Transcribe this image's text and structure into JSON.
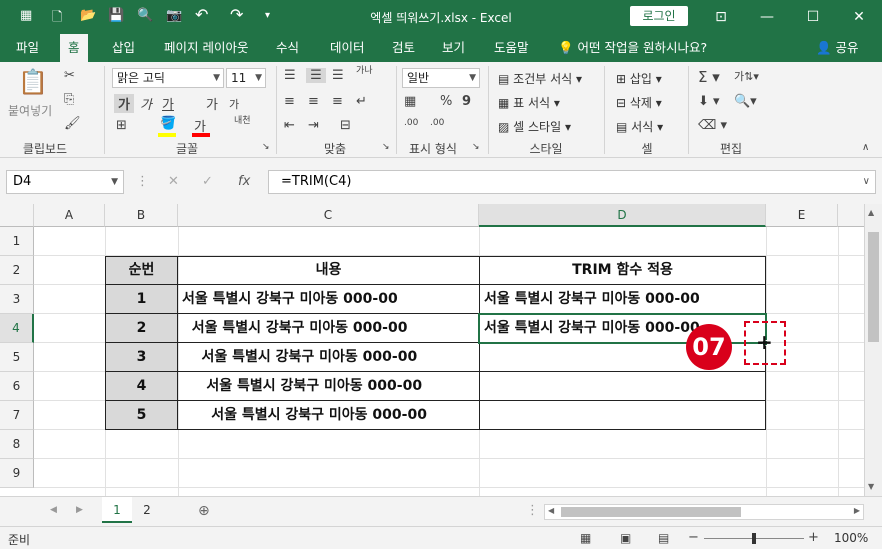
{
  "window": {
    "title": "엑셀 띄워쓰기.xlsx  -  Excel",
    "login_label": "로그인",
    "quick_access": {
      "save": "💾",
      "undo": "↶",
      "redo": "↷"
    }
  },
  "menu": {
    "tabs": [
      "파일",
      "홈",
      "삽입",
      "페이지 레이아웃",
      "수식",
      "데이터",
      "검토",
      "보기",
      "도움말"
    ],
    "active_tab": "홈",
    "tell_me": "어떤 작업을 원하시나요?",
    "share": "공유"
  },
  "ribbon": {
    "clipboard": {
      "paste": "붙여넣기",
      "label": "클립보드"
    },
    "font": {
      "name": "맑은 고딕",
      "size": "11",
      "bold": "가",
      "italic": "가",
      "underline": "가",
      "grow": "가",
      "shrink": "가",
      "phonetic": "내천",
      "color_glyph": "가",
      "label": "글꼴"
    },
    "alignment": {
      "wrap": "가나",
      "label": "맞춤"
    },
    "number": {
      "format": "일반",
      "percent": "%",
      "comma": "9",
      "inc": ".00",
      "dec": ".00",
      "label": "표시 형식"
    },
    "styles": {
      "conditional": "조건부 서식",
      "table": "표 서식",
      "cell": "셀 스타일",
      "label": "스타일"
    },
    "cells": {
      "insert": "삽입",
      "delete": "삭제",
      "format": "서식",
      "label": "셀"
    },
    "editing": {
      "sort": "가",
      "label": "편집"
    }
  },
  "formula_bar": {
    "name_box": "D4",
    "formula": "=TRIM(C4)",
    "fx": "fx"
  },
  "columns": [
    "A",
    "B",
    "C",
    "D",
    "E"
  ],
  "rows": [
    "1",
    "2",
    "3",
    "4",
    "5",
    "6",
    "7",
    "8",
    "9"
  ],
  "table": {
    "header": {
      "b": "순번",
      "c": "내용",
      "d": "TRIM 함수 적용"
    },
    "rows": [
      {
        "b": "1",
        "c": "서울 특별시 강북구 미아동 000-00",
        "d": "서울 특별시 강북구 미아동 000-00"
      },
      {
        "b": "2",
        "c": "  서울 특별시 강북구 미아동 000-00",
        "d": "서울 특별시 강북구 미아동 000-00"
      },
      {
        "b": "3",
        "c": "    서울 특별시 강북구 미아동 000-00",
        "d": ""
      },
      {
        "b": "4",
        "c": "     서울 특별시 강북구 미아동 000-00",
        "d": ""
      },
      {
        "b": "5",
        "c": "      서울 특별시 강북구 미아동 000-00",
        "d": ""
      }
    ]
  },
  "annotation": {
    "step": "07",
    "cursor": "+"
  },
  "sheets": {
    "tabs": [
      "1",
      "2"
    ],
    "active": "1"
  },
  "status": {
    "mode": "준비",
    "zoom": "100%"
  },
  "colors": {
    "excel_green": "#217346",
    "badge_red": "#d9001b",
    "header_fill": "#d9d9d9"
  }
}
